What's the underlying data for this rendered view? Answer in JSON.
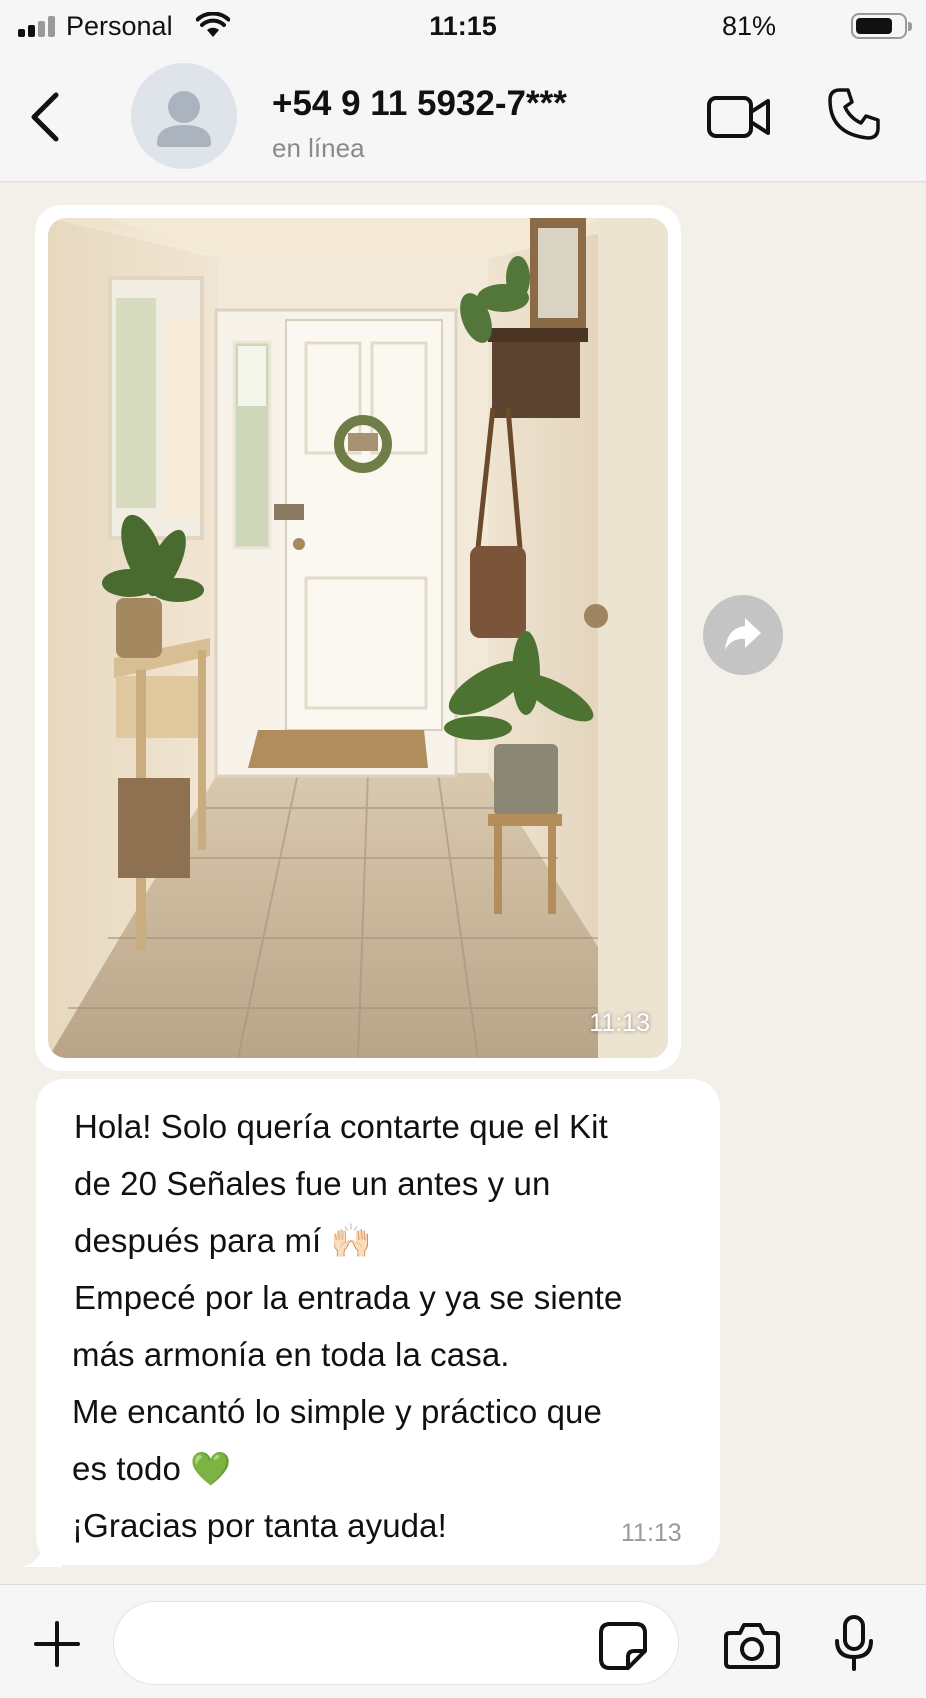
{
  "status_bar": {
    "carrier": "Personal",
    "time": "11:15",
    "battery_percent": "81%",
    "battery_level": 0.81
  },
  "header": {
    "contact_name": "+54 9 11 5932-7***",
    "contact_status": "en línea",
    "icons": [
      "back-icon",
      "avatar-placeholder-icon",
      "video-call-icon",
      "phone-icon"
    ]
  },
  "messages": [
    {
      "type": "image",
      "time": "11:13"
    },
    {
      "type": "text",
      "lines": [
        "Hola! Solo quería contarte que el Kit",
        "de 20 Señales fue un antes y un",
        "después para mí 🙌🏻",
        "Empecé por la entrada y ya se siente",
        "más armonía en toda la casa.",
        "Me encantó lo simple y práctico que",
        "es todo 💚",
        "¡Gracias por tanta ayuda!"
      ],
      "time": "11:13"
    }
  ],
  "composer": {
    "placeholder": "",
    "icons": [
      "plus-icon",
      "sticker-icon",
      "camera-icon",
      "microphone-icon"
    ]
  },
  "colors": {
    "chat_background": "#f3f0ea",
    "bar_background": "#f6f6f6",
    "bubble": "#ffffff",
    "heart": "#5bd64a"
  }
}
